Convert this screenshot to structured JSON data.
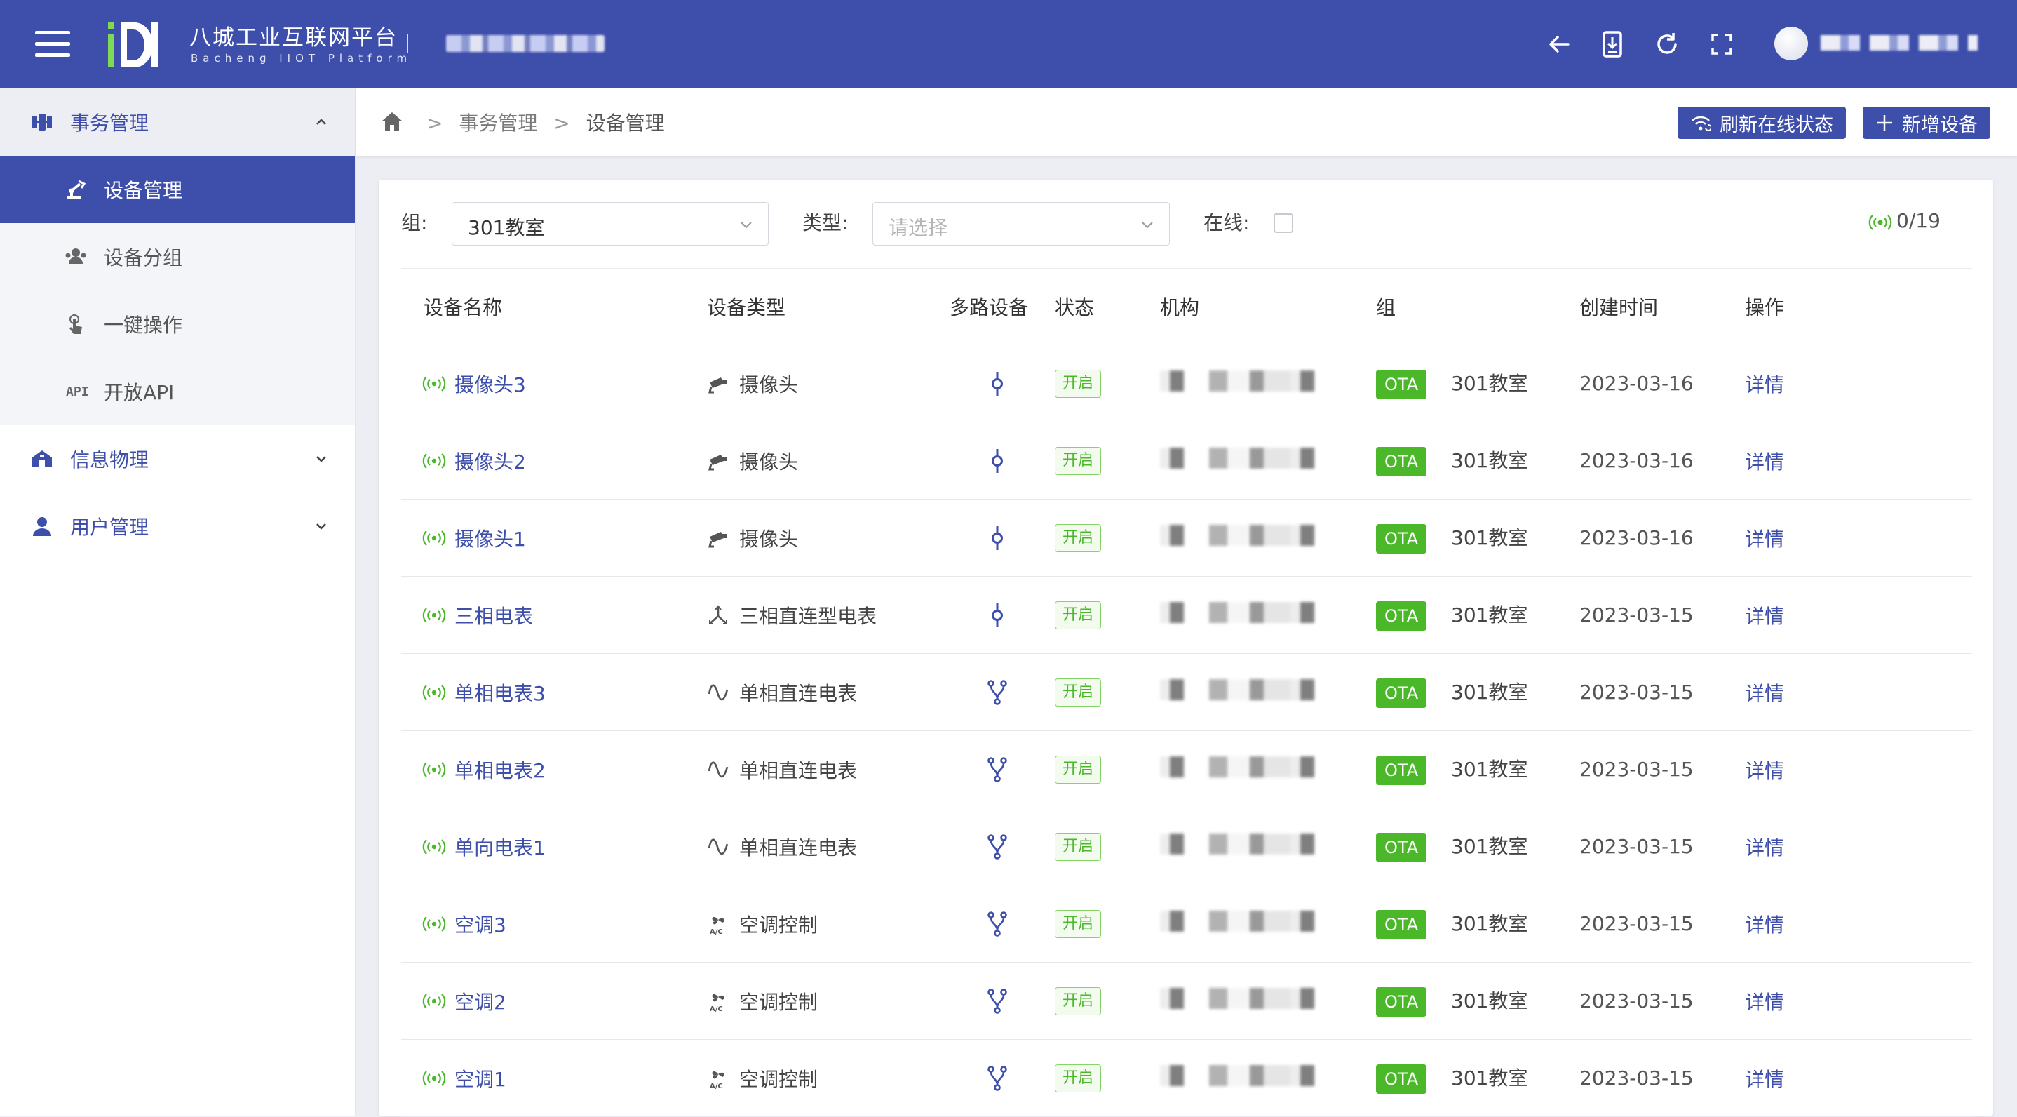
{
  "header": {
    "brand_title": "八城工业互联网平台",
    "brand_subtitle": "Bacheng IIOT Platform",
    "icons": [
      "menu-icon",
      "back-icon",
      "download-icon",
      "refresh-icon",
      "fullscreen-icon"
    ],
    "accent_color": "#3d4eab"
  },
  "sidebar": {
    "groups": [
      {
        "label": "事务管理",
        "icon": "satellite-icon",
        "expanded": true,
        "items": [
          {
            "label": "设备管理",
            "icon": "robot-arm-icon",
            "active": true
          },
          {
            "label": "设备分组",
            "icon": "group-icon",
            "active": false
          },
          {
            "label": "一键操作",
            "icon": "touch-icon",
            "active": false
          },
          {
            "label": "开放API",
            "icon": "api-icon",
            "active": false
          }
        ]
      },
      {
        "label": "信息物理",
        "icon": "building-icon",
        "expanded": false
      },
      {
        "label": "用户管理",
        "icon": "user-icon",
        "expanded": false
      }
    ]
  },
  "breadcrumb": {
    "items": [
      "事务管理",
      "设备管理"
    ],
    "separator": ">"
  },
  "actions": {
    "refresh_online": "刷新在线状态",
    "add_device": "新增设备"
  },
  "filters": {
    "group_label": "组:",
    "group_value": "301教室",
    "type_label": "类型:",
    "type_placeholder": "请选择",
    "online_label": "在线:",
    "online_checked": false,
    "online_count": "0/19"
  },
  "table": {
    "columns": [
      "设备名称",
      "设备类型",
      "多路设备",
      "状态",
      "机构",
      "组",
      "创建时间",
      "操作"
    ],
    "rows": [
      {
        "name": "摄像头3",
        "type": "摄像头",
        "type_icon": "camera-icon",
        "multi_icon": "single-channel-icon",
        "status": "开启",
        "ota": "OTA",
        "group": "301教室",
        "created": "2023-03-16",
        "action": "详情"
      },
      {
        "name": "摄像头2",
        "type": "摄像头",
        "type_icon": "camera-icon",
        "multi_icon": "single-channel-icon",
        "status": "开启",
        "ota": "OTA",
        "group": "301教室",
        "created": "2023-03-16",
        "action": "详情"
      },
      {
        "name": "摄像头1",
        "type": "摄像头",
        "type_icon": "camera-icon",
        "multi_icon": "single-channel-icon",
        "status": "开启",
        "ota": "OTA",
        "group": "301教室",
        "created": "2023-03-16",
        "action": "详情"
      },
      {
        "name": "三相电表",
        "type": "三相直连型电表",
        "type_icon": "three-phase-icon",
        "multi_icon": "single-channel-icon",
        "status": "开启",
        "ota": "OTA",
        "group": "301教室",
        "created": "2023-03-15",
        "action": "详情"
      },
      {
        "name": "单相电表3",
        "type": "单相直连电表",
        "type_icon": "sine-wave-icon",
        "multi_icon": "multi-channel-icon",
        "status": "开启",
        "ota": "OTA",
        "group": "301教室",
        "created": "2023-03-15",
        "action": "详情"
      },
      {
        "name": "单相电表2",
        "type": "单相直连电表",
        "type_icon": "sine-wave-icon",
        "multi_icon": "multi-channel-icon",
        "status": "开启",
        "ota": "OTA",
        "group": "301教室",
        "created": "2023-03-15",
        "action": "详情"
      },
      {
        "name": "单向电表1",
        "type": "单相直连电表",
        "type_icon": "sine-wave-icon",
        "multi_icon": "multi-channel-icon",
        "status": "开启",
        "ota": "OTA",
        "group": "301教室",
        "created": "2023-03-15",
        "action": "详情"
      },
      {
        "name": "空调3",
        "type": "空调控制",
        "type_icon": "ac-icon",
        "multi_icon": "multi-channel-icon",
        "status": "开启",
        "ota": "OTA",
        "group": "301教室",
        "created": "2023-03-15",
        "action": "详情"
      },
      {
        "name": "空调2",
        "type": "空调控制",
        "type_icon": "ac-icon",
        "multi_icon": "multi-channel-icon",
        "status": "开启",
        "ota": "OTA",
        "group": "301教室",
        "created": "2023-03-15",
        "action": "详情"
      },
      {
        "name": "空调1",
        "type": "空调控制",
        "type_icon": "ac-icon",
        "multi_icon": "multi-channel-icon",
        "status": "开启",
        "ota": "OTA",
        "group": "301教室",
        "created": "2023-03-15",
        "action": "详情"
      }
    ]
  },
  "colors": {
    "primary": "#3d4eab",
    "online_green": "#4bb82a",
    "status_border": "#86d466"
  }
}
